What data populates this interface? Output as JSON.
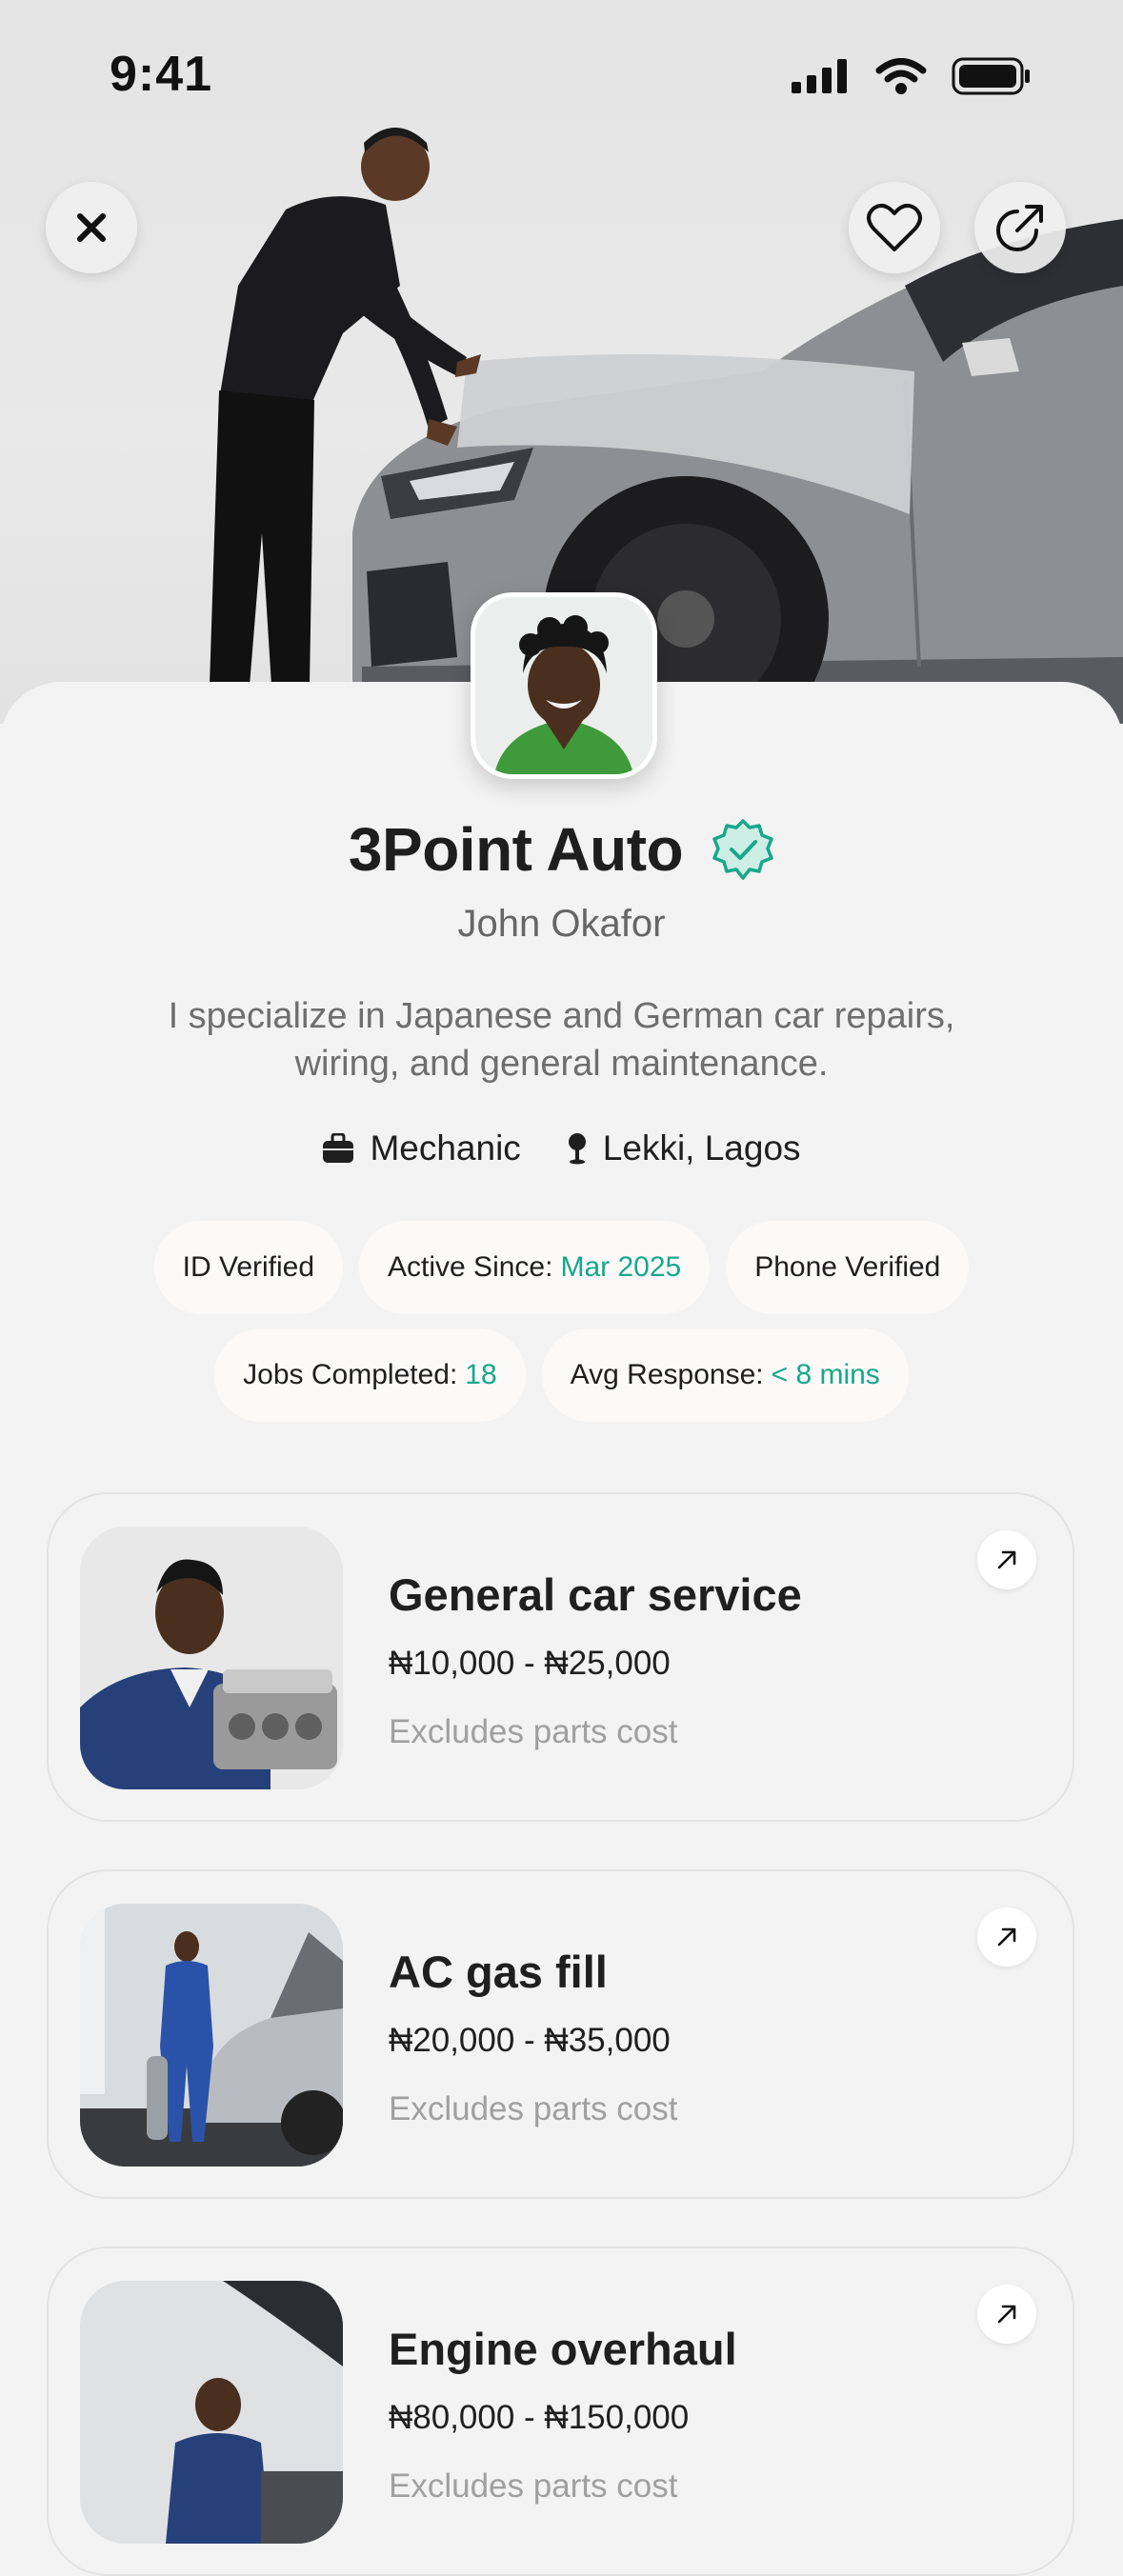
{
  "status_bar": {
    "time": "9:41"
  },
  "profile": {
    "business_name": "3Point Auto",
    "owner_name": "John Okafor",
    "bio": "I specialize in Japanese and German car repairs, wiring, and general maintenance.",
    "category": "Mechanic",
    "location": "Lekki, Lagos"
  },
  "badges": {
    "id_verified": "ID Verified",
    "active_since_label": "Active Since:",
    "active_since_value": "Mar 2025",
    "phone_verified": "Phone Verified",
    "jobs_label": "Jobs Completed:",
    "jobs_value": "18",
    "response_label": "Avg Response:",
    "response_value": "< 8 mins"
  },
  "services": [
    {
      "title": "General car service",
      "price": "₦10,000 - ₦25,000",
      "note": "Excludes parts cost"
    },
    {
      "title": "AC gas fill",
      "price": "₦20,000 - ₦35,000",
      "note": "Excludes parts cost"
    },
    {
      "title": "Engine overhaul",
      "price": "₦80,000 - ₦150,000",
      "note": "Excludes parts cost"
    }
  ],
  "colors": {
    "accent": "#17a88a",
    "background": "#f3f3f3",
    "chip": "#fbfaf9"
  },
  "icons": [
    "close-icon",
    "heart-icon",
    "share-icon",
    "verified-badge-icon",
    "briefcase-icon",
    "location-pin-icon",
    "arrow-up-right-icon"
  ]
}
